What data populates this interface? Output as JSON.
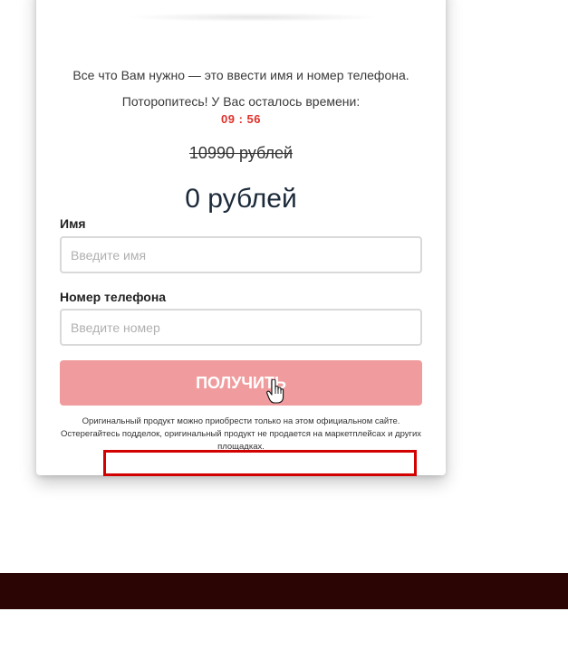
{
  "form": {
    "intro_text": "Все что Вам нужно — это ввести имя и номер телефона.",
    "hurry_text": "Поторопитесь! У Вас осталось времени:",
    "timer": "09 : 56",
    "old_price": "10990 рублей",
    "new_price": "0 рублей",
    "name_label": "Имя",
    "name_placeholder": "Введите имя",
    "phone_label": "Номер телефона",
    "phone_placeholder": "Введите номер",
    "submit_label": "ПОЛУЧИТЬ",
    "disclaimer": "Оригинальный продукт можно приобрести только на этом официальном сайте. Остерегайтесь подделок, оригинальный продукт не продается на маркетплейсах и других площадках."
  },
  "colors": {
    "timer": "#e0302a",
    "button": "#f09b9d",
    "footer": "#2a0504",
    "highlight_box": "#d30000"
  },
  "icons": {
    "cursor": "hand-pointer-icon",
    "product": "product-image"
  }
}
